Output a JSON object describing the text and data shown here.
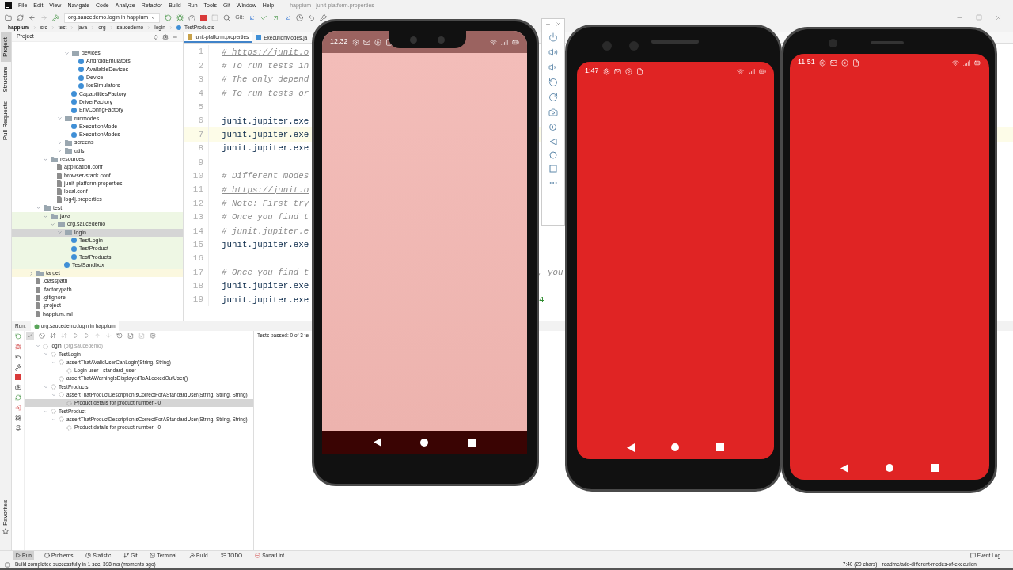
{
  "window": {
    "title": "happium - junit-platform.properties"
  },
  "menu": [
    "File",
    "Edit",
    "View",
    "Navigate",
    "Code",
    "Analyze",
    "Refactor",
    "Build",
    "Run",
    "Tools",
    "Git",
    "Window",
    "Help"
  ],
  "toolbar": {
    "run_config": "org.saucedemo.login in happium",
    "git_label": "Git:"
  },
  "breadcrumbs": [
    "happium",
    "src",
    "test",
    "java",
    "org",
    "saucedemo",
    "login",
    "TestProducts"
  ],
  "side_tabs": [
    {
      "label": "Project",
      "selected": true
    },
    {
      "label": "Structure",
      "selected": false
    },
    {
      "label": "Pull Requests",
      "selected": false
    }
  ],
  "favorites_tab": "Favorites",
  "project": {
    "title": "Project",
    "tree": [
      {
        "kind": "clipped",
        "children": [
          {
            "kind": "clipped",
            "children": [
              {
                "kind": "clipped",
                "children": [
                  {
                    "kind": "clipped",
                    "children": [
                      {
                        "kind": "clipped",
                        "children": [
                          {
                            "kind": "folder",
                            "label": "devices",
                            "expanded": true,
                            "selected": false,
                            "children": [
                              {
                                "kind": "class",
                                "label": "AndroidEmulators",
                                "selected": false
                              },
                              {
                                "kind": "class",
                                "label": "AvailableDevices",
                                "selected": false
                              },
                              {
                                "kind": "class",
                                "label": "Device",
                                "selected": false
                              },
                              {
                                "kind": "class",
                                "label": "IosSimulators",
                                "selected": false
                              }
                            ]
                          },
                          {
                            "kind": "class",
                            "label": "CapabilitiesFactory",
                            "selected": false
                          },
                          {
                            "kind": "class",
                            "label": "DriverFactory",
                            "selected": false
                          },
                          {
                            "kind": "class",
                            "label": "EnvConfigFactory",
                            "selected": false
                          }
                        ]
                      },
                      {
                        "kind": "folder",
                        "label": "runmodes",
                        "expanded": true,
                        "selected": false,
                        "children": [
                          {
                            "kind": "class",
                            "label": "ExecutionMode",
                            "selected": false
                          },
                          {
                            "kind": "class",
                            "label": "ExecutionModes",
                            "selected": false
                          }
                        ]
                      },
                      {
                        "kind": "folder",
                        "label": "screens",
                        "expanded": false,
                        "selected": false
                      },
                      {
                        "kind": "folder",
                        "label": "utils",
                        "expanded": false,
                        "selected": false
                      }
                    ]
                  }
                ]
              },
              {
                "kind": "folder",
                "label": "resources",
                "expanded": true,
                "selected": false,
                "children": [
                  {
                    "kind": "file",
                    "label": "application.conf",
                    "selected": false
                  },
                  {
                    "kind": "file",
                    "label": "browser-stack.conf",
                    "selected": false
                  },
                  {
                    "kind": "file",
                    "label": "junit-platform.properties",
                    "selected": false
                  },
                  {
                    "kind": "file",
                    "label": "local.conf",
                    "selected": false
                  },
                  {
                    "kind": "file",
                    "label": "log4j.properties",
                    "selected": false
                  }
                ]
              }
            ]
          },
          {
            "kind": "folder",
            "label": "test",
            "expanded": true,
            "selected": false,
            "children": [
              {
                "kind": "folder",
                "label": "java",
                "expanded": true,
                "selected": false,
                "color": "#eef7e4",
                "children": [
                  {
                    "kind": "folder",
                    "label": "org.saucedemo",
                    "expanded": true,
                    "selected": false,
                    "color": "#eef7e4",
                    "children": [
                      {
                        "kind": "folder",
                        "label": "login",
                        "expanded": true,
                        "selected": true,
                        "children": [
                          {
                            "kind": "class",
                            "label": "TestLogin",
                            "selected": false,
                            "color": "#eef7e4"
                          },
                          {
                            "kind": "class",
                            "label": "TestProduct",
                            "selected": false,
                            "color": "#eef7e4"
                          },
                          {
                            "kind": "class",
                            "label": "TestProducts",
                            "selected": false,
                            "color": "#eef7e4"
                          }
                        ]
                      },
                      {
                        "kind": "class",
                        "label": "TestSandbox",
                        "selected": false,
                        "color": "#eef7e4"
                      }
                    ]
                  }
                ]
              }
            ]
          }
        ]
      },
      {
        "kind": "folder",
        "label": "target",
        "expanded": false,
        "selected": false,
        "color": "#fbf8df"
      },
      {
        "kind": "file",
        "label": ".classpath",
        "selected": false
      },
      {
        "kind": "file",
        "label": ".factorypath",
        "selected": false
      },
      {
        "kind": "file",
        "label": ".gitignore",
        "selected": false
      },
      {
        "kind": "file",
        "label": ".project",
        "selected": false
      },
      {
        "kind": "file",
        "label": "happium.iml",
        "selected": false
      }
    ]
  },
  "editor": {
    "tabs": [
      {
        "label": "junit-platform.properties",
        "selected": true
      },
      {
        "label": "ExecutionModes.ja",
        "selected": false
      }
    ],
    "lines": [
      {
        "number": "1",
        "text": "# https://junit.o",
        "kind": "link",
        "current": false
      },
      {
        "number": "2",
        "text": "# To run tests in",
        "kind": "comment",
        "current": false
      },
      {
        "number": "3",
        "text": "# The only depend",
        "kind": "comment",
        "current": false
      },
      {
        "number": "4",
        "text": "# To run tests or",
        "kind": "comment",
        "current": false
      },
      {
        "number": "5",
        "current": false
      },
      {
        "number": "6",
        "text": "junit.jupiter.exe",
        "kind": "code",
        "current": false
      },
      {
        "number": "7",
        "text": "junit.jupiter.exe",
        "kind": "code",
        "current": true
      },
      {
        "number": "8",
        "text": "junit.jupiter.exe",
        "kind": "code",
        "current": false
      },
      {
        "number": "9",
        "current": false
      },
      {
        "number": "10",
        "text": "# Different modes",
        "kind": "comment",
        "current": false
      },
      {
        "number": "11",
        "text": "# https://junit.o",
        "kind": "link",
        "current": false
      },
      {
        "number": "12",
        "text": "# Note: First try",
        "kind": "comment",
        "current": false
      },
      {
        "number": "13",
        "text": "# Once you find t",
        "kind": "comment",
        "current": false
      },
      {
        "number": "14",
        "text": "# junit.jupiter.e",
        "kind": "comment",
        "current": false
      },
      {
        "number": "15",
        "text": "junit.jupiter.exe",
        "kind": "code",
        "current": false
      },
      {
        "number": "16",
        "current": false
      },
      {
        "number": "17",
        "text": "# Once you find t",
        "kind": "comment",
        "current": false,
        "tail": ", you"
      },
      {
        "number": "18",
        "text": "junit.jupiter.exe",
        "kind": "code",
        "current": false
      },
      {
        "number": "19",
        "text": "junit.jupiter.exe",
        "kind": "code",
        "current": false,
        "tail": "4"
      }
    ]
  },
  "run": {
    "label": "Run:",
    "tab": "org.saucedemo.login in happium",
    "summary": "Tests passed: 0 of 3 te",
    "tree": [
      {
        "label": "login",
        "note": "(org.saucedemo)",
        "expanded": true,
        "selected": false,
        "children": [
          {
            "label": "TestLogin",
            "expanded": true,
            "selected": false,
            "children": [
              {
                "label": "assertThatAValidUserCanLogin(String, String)",
                "expanded": true,
                "selected": false,
                "children": [
                  {
                    "label": "Login user - standard_user",
                    "selected": false
                  }
                ]
              },
              {
                "label": "assertThatAWarningIsDisplayedToALockedOutUser()",
                "selected": false
              }
            ]
          },
          {
            "label": "TestProducts",
            "expanded": true,
            "selected": false,
            "children": [
              {
                "label": "assertThatProductDescriptionIsCorrectForAStandardUser(String, String, String)",
                "expanded": true,
                "selected": false,
                "children": [
                  {
                    "label": "Product details for product number - 0",
                    "selected": true
                  }
                ]
              }
            ]
          },
          {
            "label": "TestProduct",
            "expanded": true,
            "selected": false,
            "children": [
              {
                "label": "assertThatProductDescriptionIsCorrectForAStandardUser(String, String, String)",
                "expanded": true,
                "selected": false,
                "children": [
                  {
                    "label": "Product details for product number - 0",
                    "selected": false
                  }
                ]
              }
            ]
          }
        ]
      }
    ]
  },
  "tool_tabs": [
    {
      "label": "Run",
      "kind": "run",
      "selected": true
    },
    {
      "label": "Problems",
      "kind": "problems",
      "selected": false
    },
    {
      "label": "Statistic",
      "kind": "statistic",
      "selected": false
    },
    {
      "label": "Git",
      "kind": "git",
      "selected": false
    },
    {
      "label": "Terminal",
      "kind": "terminal",
      "selected": false
    },
    {
      "label": "Build",
      "kind": "build",
      "selected": false
    },
    {
      "label": "TODO",
      "kind": "todo",
      "selected": false
    },
    {
      "label": "SonarLint",
      "kind": "sonarlint",
      "selected": false
    }
  ],
  "event_log": "Event Log",
  "status_bar": {
    "message": "Build completed successfully in 1 sec, 398 ms (moments ago)",
    "position": "7:40 (20 chars)",
    "branch": "readme/add-different-modes-of-execution"
  },
  "phones": [
    {
      "kind": "notch",
      "time": "12:32",
      "color": "#f0b8b4"
    },
    {
      "kind": "bezel",
      "time": "1:47",
      "color": "#e02424"
    },
    {
      "kind": "slim",
      "time": "11:51",
      "color": "#e02424"
    }
  ]
}
